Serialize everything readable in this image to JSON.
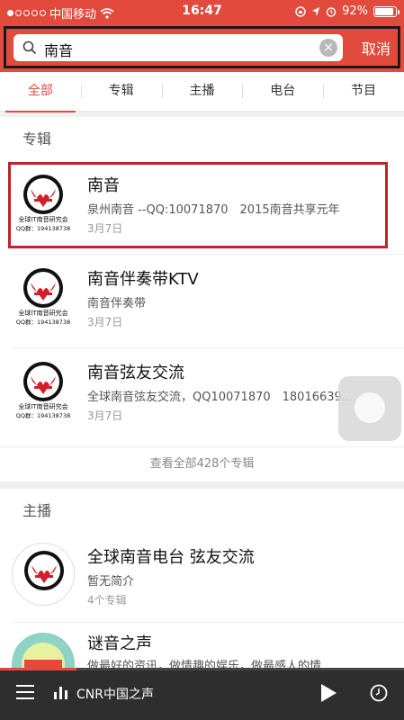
{
  "status": {
    "carrier": "中国移动",
    "time": "16:47",
    "battery": "92%",
    "battery_level": 0.92
  },
  "search": {
    "query": "南音",
    "cancel_label": "取消"
  },
  "tabs": [
    {
      "label": "全部",
      "active": true
    },
    {
      "label": "专辑",
      "active": false
    },
    {
      "label": "主播",
      "active": false
    },
    {
      "label": "电台",
      "active": false
    },
    {
      "label": "节目",
      "active": false
    }
  ],
  "albums": {
    "section_title": "专辑",
    "items": [
      {
        "title": "南音",
        "desc": "泉州南音 --QQ:10071870　2015南音共享元年",
        "date": "3月7日"
      },
      {
        "title": "南音伴奏带KTV",
        "desc": "南音伴奏带",
        "date": "3月7日"
      },
      {
        "title": "南音弦友交流",
        "desc": "全球南音弦友交流，QQ10071870　18016639...",
        "date": "3月7日"
      }
    ],
    "see_all": "查看全部428个专辑"
  },
  "cover_logo": {
    "line1": "全球IT南音研究会",
    "line2": "QQ群：194138738"
  },
  "anchors": {
    "section_title": "主播",
    "items": [
      {
        "title": "全球南音电台 弦友交流",
        "desc": "暂无简介",
        "count": "4个专辑"
      },
      {
        "title": "谜音之声",
        "desc": "做最好的资讯，做情趣的娱乐，做最感人的情..."
      }
    ]
  },
  "player": {
    "title": "CNR中国之声",
    "progress": 0.19
  },
  "colors": {
    "accent": "#e24a3e",
    "highlight_border": "#c0212a",
    "player_bg": "#2e2e2e"
  }
}
